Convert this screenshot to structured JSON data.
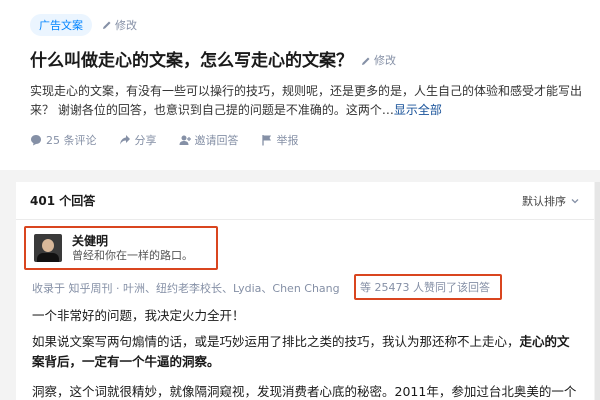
{
  "question": {
    "topic_tag": "广告文案",
    "edit_label": "修改",
    "title": "什么叫做走心的文案，怎么写走心的文案？",
    "title_edit_label": "修改",
    "description": "实现走心的文案，有没有一些可以操行的技巧，规则呢，还是更多的是，人生自己的体验和感受才能写出来？ 谢谢各位的回答，也意识到自己提的问题是不准确的。这两个…",
    "show_all": "显示全部",
    "actions": {
      "comments": "25 条评论",
      "share": "分享",
      "invite": "邀请回答",
      "report": "举报"
    }
  },
  "answers": {
    "count_label": "401 个回答",
    "sort_label": "默认排序",
    "first_answer": {
      "author_name": "关健明",
      "author_bio": "曾经和你在一样的路口。",
      "collected_by": "收录于 知乎周刊 · 叶洲、纽约老李校长、Lydia、Chen Chang",
      "votes": "等 25473 人赞同了该回答",
      "p1": "一个非常好的问题，我决定火力全开！",
      "p2_normal": "如果说文案写两句煽情的话，或是巧妙运用了排比之类的技巧，我认为那还称不上走心，",
      "p2_bold": "走心的文案背后，一定有一个牛逼的洞察。",
      "p3": "洞察，这个词就很精妙，就像隔洞窥视，发现消费者心底的秘密。2011年，参加过台北奥美的一个"
    }
  },
  "icons": {
    "edit": "pencil-icon",
    "comments": "comment-icon",
    "share": "share-icon",
    "invite": "invite-icon",
    "report": "flag-icon",
    "sort": "chevron-down-icon"
  },
  "colors": {
    "accent": "#0084ff",
    "highlight_border": "#d9451f",
    "muted": "#8590a6"
  }
}
